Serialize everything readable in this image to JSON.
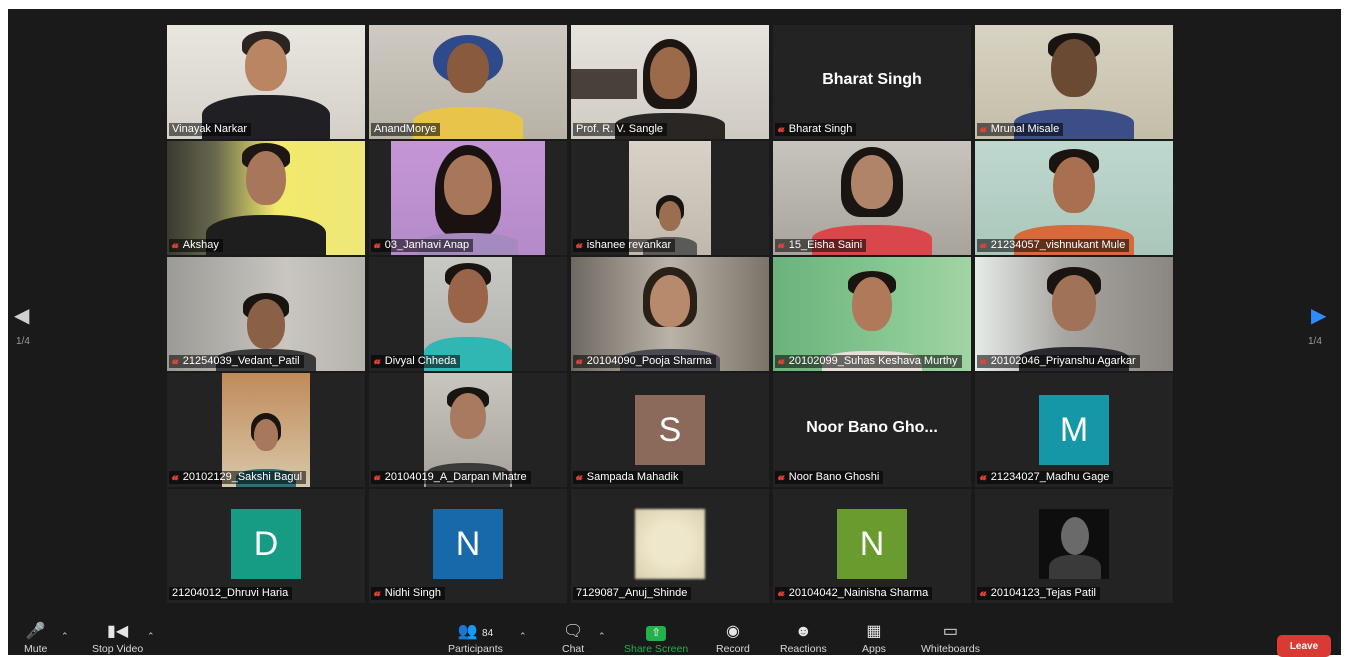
{
  "pagination": {
    "left": "1/4",
    "right": "1/4"
  },
  "participants": [
    {
      "name": "Vinayak Narkar",
      "muted": false
    },
    {
      "name": "AnandMorye",
      "muted": false
    },
    {
      "name": "Prof. R. V. Sangle",
      "muted": false
    },
    {
      "name": "Bharat Singh",
      "muted": true,
      "big_name": "Bharat Singh"
    },
    {
      "name": "Mrunal Misale",
      "muted": true
    },
    {
      "name": "Akshay",
      "muted": true
    },
    {
      "name": "03_Janhavi Anap",
      "muted": true
    },
    {
      "name": "ishanee revankar",
      "muted": true
    },
    {
      "name": "15_Eisha Saini",
      "muted": true
    },
    {
      "name": "21234057_vishnukant Mule",
      "muted": true
    },
    {
      "name": "21254039_Vedant_Patil",
      "muted": true
    },
    {
      "name": "Divyal Chheda",
      "muted": true
    },
    {
      "name": "20104090_Pooja Sharma",
      "muted": true
    },
    {
      "name": "20102099_Suhas Keshava Murthy",
      "muted": true
    },
    {
      "name": "20102046_Priyanshu Agarkar",
      "muted": true
    },
    {
      "name": "20102129_Sakshi Bagul",
      "muted": true
    },
    {
      "name": "20104019_A_Darpan Mhatre",
      "muted": true
    },
    {
      "name": "Sampada Mahadik",
      "muted": true,
      "avatar": "S",
      "avatar_color": "#8b6a5c"
    },
    {
      "name": "Noor Bano Ghoshi",
      "muted": true,
      "big_name": "Noor Bano Gho..."
    },
    {
      "name": "21234027_Madhu Gage",
      "muted": true,
      "avatar": "M",
      "avatar_color": "#1597a8"
    },
    {
      "name": "21204012_Dhruvi Haria",
      "muted": false,
      "avatar": "D",
      "avatar_color": "#169b84"
    },
    {
      "name": "Nidhi Singh",
      "muted": true,
      "avatar": "N",
      "avatar_color": "#1769aa"
    },
    {
      "name": "7129087_Anuj_Shinde",
      "muted": false
    },
    {
      "name": "20104042_Nainisha Sharma",
      "muted": true,
      "avatar": "N",
      "avatar_color": "#6a9b2f"
    },
    {
      "name": "20104123_Tejas Patil",
      "muted": true
    }
  ],
  "toolbar": {
    "mute": "Mute",
    "stop_video": "Stop Video",
    "participants": "Participants",
    "participants_count": "84",
    "chat": "Chat",
    "share_screen": "Share Screen",
    "record": "Record",
    "reactions": "Reactions",
    "apps": "Apps",
    "whiteboards": "Whiteboards",
    "leave": "Leave"
  },
  "colors": {
    "active_speaker_border": "#c8e26a",
    "share_screen_green": "#22b14c",
    "leave_red": "#d93b34",
    "next_arrow": "#2d8cff"
  }
}
